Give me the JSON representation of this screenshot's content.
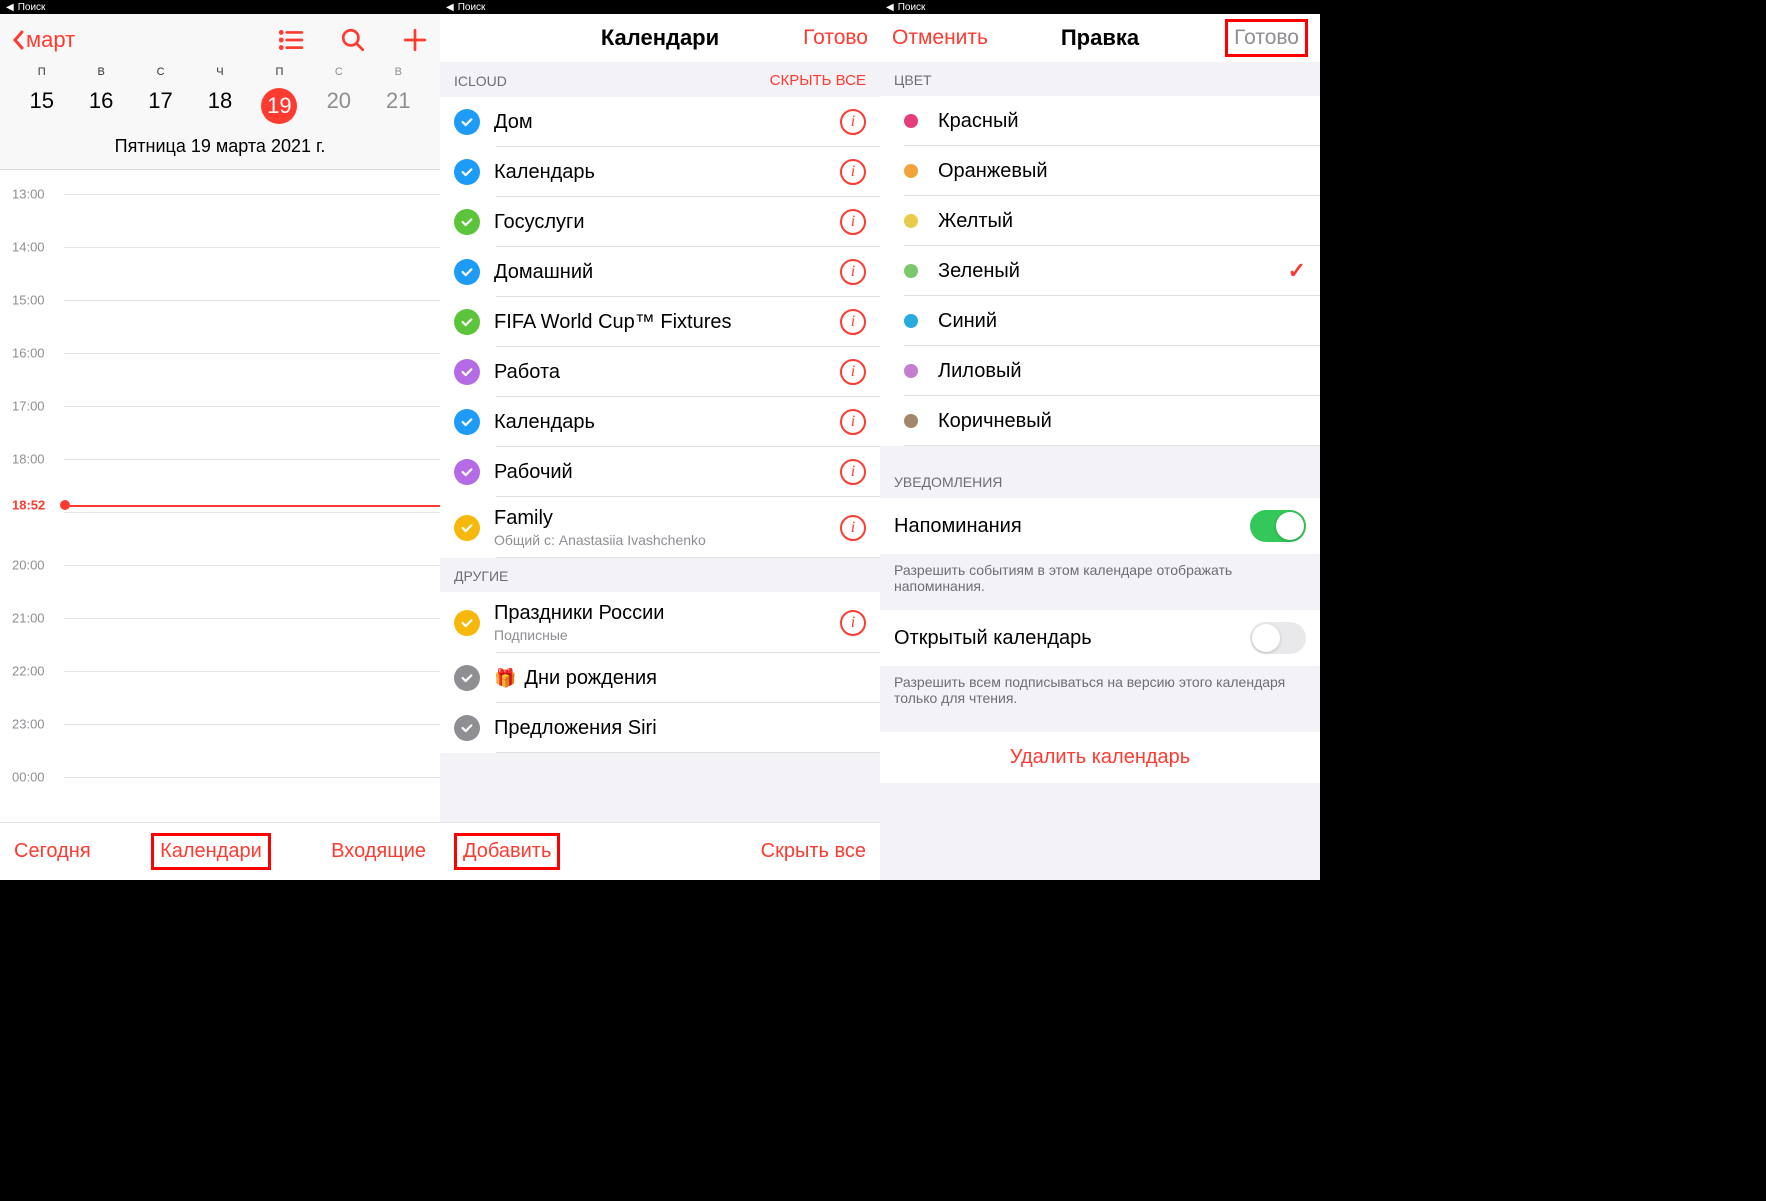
{
  "status": {
    "back_label": "Поиск"
  },
  "screen1": {
    "back": "март",
    "days": [
      {
        "letter": "П",
        "num": "15"
      },
      {
        "letter": "В",
        "num": "16"
      },
      {
        "letter": "С",
        "num": "17"
      },
      {
        "letter": "Ч",
        "num": "18"
      },
      {
        "letter": "П",
        "num": "19",
        "today": true
      },
      {
        "letter": "С",
        "num": "20",
        "weekend": true
      },
      {
        "letter": "В",
        "num": "21",
        "weekend": true
      }
    ],
    "date_string": "Пятница  19 марта 2021 г.",
    "hours": [
      "13:00",
      "14:00",
      "15:00",
      "16:00",
      "17:00",
      "18:00",
      "",
      "20:00",
      "21:00",
      "22:00",
      "23:00",
      "00:00"
    ],
    "now": "18:52",
    "toolbar": {
      "today": "Сегодня",
      "calendars": "Календари",
      "inbox": "Входящие"
    }
  },
  "screen2": {
    "title": "Календари",
    "done": "Готово",
    "section1_header": "ICLOUD",
    "hide_all": "СКРЫТЬ ВСЕ",
    "icloud": [
      {
        "label": "Дом",
        "color": "#1d9bf6"
      },
      {
        "label": "Календарь",
        "color": "#1d9bf6"
      },
      {
        "label": "Госуслуги",
        "color": "#5bc43b"
      },
      {
        "label": "Домашний",
        "color": "#1d9bf6"
      },
      {
        "label": "FIFA World Cup™ Fixtures",
        "color": "#5bc43b"
      },
      {
        "label": "Работа",
        "color": "#b56be6"
      },
      {
        "label": "Календарь",
        "color": "#1d9bf6"
      },
      {
        "label": "Рабочий",
        "color": "#b56be6"
      },
      {
        "label": "Family",
        "color": "#f7b80d",
        "sub": "Общий с: Anastasiia Ivashchenko"
      }
    ],
    "section2_header": "ДРУГИЕ",
    "other": [
      {
        "label": "Праздники России",
        "color": "#f7b80d",
        "sub": "Подписные",
        "info": true
      },
      {
        "label": "Дни рождения",
        "color": "#8e8e93",
        "gift": true
      },
      {
        "label": "Предложения Siri",
        "color": "#8e8e93"
      }
    ],
    "toolbar": {
      "add": "Добавить",
      "hide_all": "Скрыть все"
    }
  },
  "screen3": {
    "cancel": "Отменить",
    "title": "Правка",
    "done": "Готово",
    "color_header": "ЦВЕТ",
    "colors": [
      {
        "label": "Красный",
        "hex": "#e63e7c"
      },
      {
        "label": "Оранжевый",
        "hex": "#f2a33c"
      },
      {
        "label": "Желтый",
        "hex": "#e8cc4d"
      },
      {
        "label": "Зеленый",
        "hex": "#7bc86c",
        "selected": true
      },
      {
        "label": "Синий",
        "hex": "#29abe2"
      },
      {
        "label": "Лиловый",
        "hex": "#c47dd0"
      },
      {
        "label": "Коричневый",
        "hex": "#a3876a"
      }
    ],
    "notif_header": "УВЕДОМЛЕНИЯ",
    "remind_label": "Напоминания",
    "remind_note": "Разрешить событиям в этом календаре отображать напоминания.",
    "public_label": "Открытый календарь",
    "public_note": "Разрешить всем подписываться на версию этого календаря только для чтения.",
    "delete": "Удалить календарь"
  }
}
